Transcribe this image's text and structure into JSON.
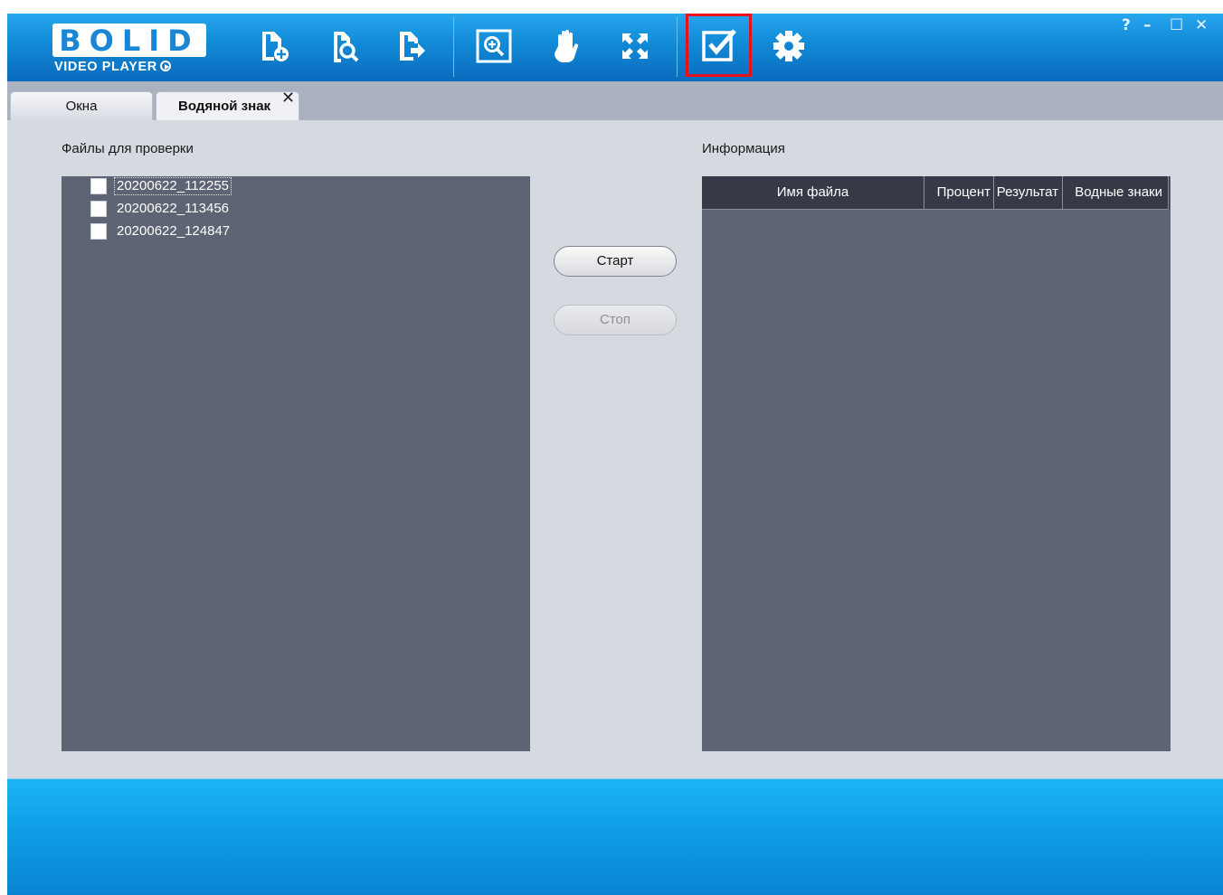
{
  "app": {
    "logo_text": "BOLID",
    "logo_subtitle": "VIDEO PLAYER",
    "accent_color": "#1189d6",
    "highlight_color": "#e8101a"
  },
  "toolbar": {
    "items": [
      {
        "name": "add-file-icon",
        "tooltip": ""
      },
      {
        "name": "search-file-icon",
        "tooltip": ""
      },
      {
        "name": "export-icon",
        "tooltip": ""
      },
      {
        "name": "zoom-icon",
        "tooltip": ""
      },
      {
        "name": "hand-pan-icon",
        "tooltip": ""
      },
      {
        "name": "fullscreen-icon",
        "tooltip": ""
      },
      {
        "name": "watermark-check-icon",
        "selected": true
      },
      {
        "name": "settings-gear-icon",
        "tooltip": ""
      }
    ],
    "window_controls": {
      "help": "?",
      "minimize": "–",
      "maximize": "☐",
      "close": "✕"
    }
  },
  "tabs": [
    {
      "label": "Окна",
      "active": false
    },
    {
      "label": "Водяной знак",
      "active": true,
      "close": "✕"
    }
  ],
  "left": {
    "title": "Файлы для проверки",
    "files": [
      {
        "name": "20200622_112255",
        "checked": false,
        "focused": true
      },
      {
        "name": "20200622_113456",
        "checked": false,
        "focused": false
      },
      {
        "name": "20200622_124847",
        "checked": false,
        "focused": false
      }
    ]
  },
  "buttons": {
    "start": "Старт",
    "stop": "Стоп"
  },
  "right": {
    "title": "Информация",
    "columns": [
      "Имя файла",
      "Процент",
      "Результат",
      "Водные знаки"
    ],
    "rows": []
  }
}
